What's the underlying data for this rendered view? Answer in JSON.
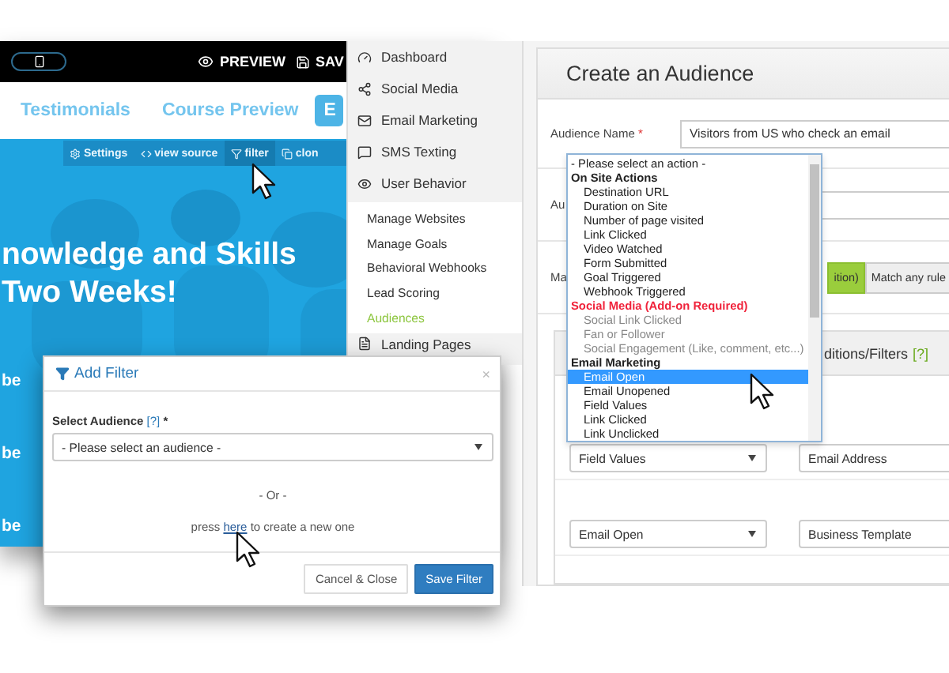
{
  "editor": {
    "preview": "PREVIEW",
    "save": "SAV",
    "nav": [
      {
        "label": "Testimonials"
      },
      {
        "label": "Course Preview"
      }
    ],
    "nav_button": "E",
    "block_tools": [
      {
        "label": "Settings",
        "kind": "settings",
        "selected": false
      },
      {
        "label": "view source",
        "kind": "code",
        "selected": false
      },
      {
        "label": "filter",
        "kind": "filter",
        "selected": true
      },
      {
        "label": "clon",
        "kind": "clone",
        "selected": false
      }
    ],
    "headline": [
      "nowledge and Skills",
      "Two Weeks!"
    ],
    "side_texts": [
      "be",
      "be",
      "be"
    ]
  },
  "sidebar": {
    "items": [
      {
        "label": "Dashboard",
        "kind": "dashboard"
      },
      {
        "label": "Social Media",
        "kind": "share"
      },
      {
        "label": "Email Marketing",
        "kind": "mail"
      },
      {
        "label": "SMS Texting",
        "kind": "chat"
      },
      {
        "label": "User Behavior",
        "kind": "eye"
      }
    ],
    "sub_items": [
      {
        "label": "Manage Websites",
        "selected": false
      },
      {
        "label": "Manage Goals",
        "selected": false
      },
      {
        "label": "Behavioral Webhooks",
        "selected": false
      },
      {
        "label": "Lead Scoring",
        "selected": false
      },
      {
        "label": "Audiences",
        "selected": true
      }
    ],
    "next_item": {
      "label": "Landing Pages",
      "kind": "page"
    }
  },
  "audience_form": {
    "title": "Create an Audience",
    "name_label": "Audience Name",
    "required": "*",
    "name_value": "Visitors from US who check an email",
    "row2_label": "Au",
    "row3_label": "Ma",
    "match_buttons": [
      {
        "label": "ition)",
        "selected": true
      },
      {
        "label": "Match any rule",
        "selected": false
      }
    ],
    "conditions_title": "ditions/Filters",
    "conditions_help": "[?]",
    "rules": [
      {
        "action": "Field Values",
        "target": "Email Address"
      },
      {
        "action": "Email Open",
        "target": "Business Template"
      }
    ]
  },
  "action_dropdown": {
    "placeholder_option": "- Please select an action -",
    "groups": [
      {
        "label": "On Site Actions",
        "kind": "normal",
        "options": [
          {
            "label": "Destination URL",
            "selected": false,
            "disabled": false
          },
          {
            "label": "Duration on Site",
            "selected": false,
            "disabled": false
          },
          {
            "label": "Number of page visited",
            "selected": false,
            "disabled": false
          },
          {
            "label": "Link Clicked",
            "selected": false,
            "disabled": false
          },
          {
            "label": "Video Watched",
            "selected": false,
            "disabled": false
          },
          {
            "label": "Form Submitted",
            "selected": false,
            "disabled": false
          },
          {
            "label": "Goal Triggered",
            "selected": false,
            "disabled": false
          },
          {
            "label": "Webhook Triggered",
            "selected": false,
            "disabled": false
          }
        ]
      },
      {
        "label": "Social Media (Add-on Required)",
        "kind": "addon",
        "options": [
          {
            "label": "Social Link Clicked",
            "selected": false,
            "disabled": true
          },
          {
            "label": "Fan or Follower",
            "selected": false,
            "disabled": true
          },
          {
            "label": "Social Engagement (Like, comment, etc...)",
            "selected": false,
            "disabled": true
          }
        ]
      },
      {
        "label": "Email Marketing",
        "kind": "normal",
        "options": [
          {
            "label": "Email Open",
            "selected": true,
            "disabled": false
          },
          {
            "label": "Email Unopened",
            "selected": false,
            "disabled": false
          },
          {
            "label": "Field Values",
            "selected": false,
            "disabled": false
          },
          {
            "label": "Link Clicked",
            "selected": false,
            "disabled": false
          },
          {
            "label": "Link Unclicked",
            "selected": false,
            "disabled": false
          }
        ]
      }
    ]
  },
  "modal": {
    "title": "Add Filter",
    "close": "×",
    "field_label": "Select Audience",
    "help": "[?]",
    "required": "*",
    "select_placeholder": "- Please select an audience -",
    "separator": "- Or -",
    "hint_before": "press",
    "link": "here",
    "hint_after": "to create a new one",
    "buttons": [
      {
        "label": "Cancel & Close",
        "kind": "secondary"
      },
      {
        "label": "Save Filter",
        "kind": "primary"
      }
    ]
  }
}
